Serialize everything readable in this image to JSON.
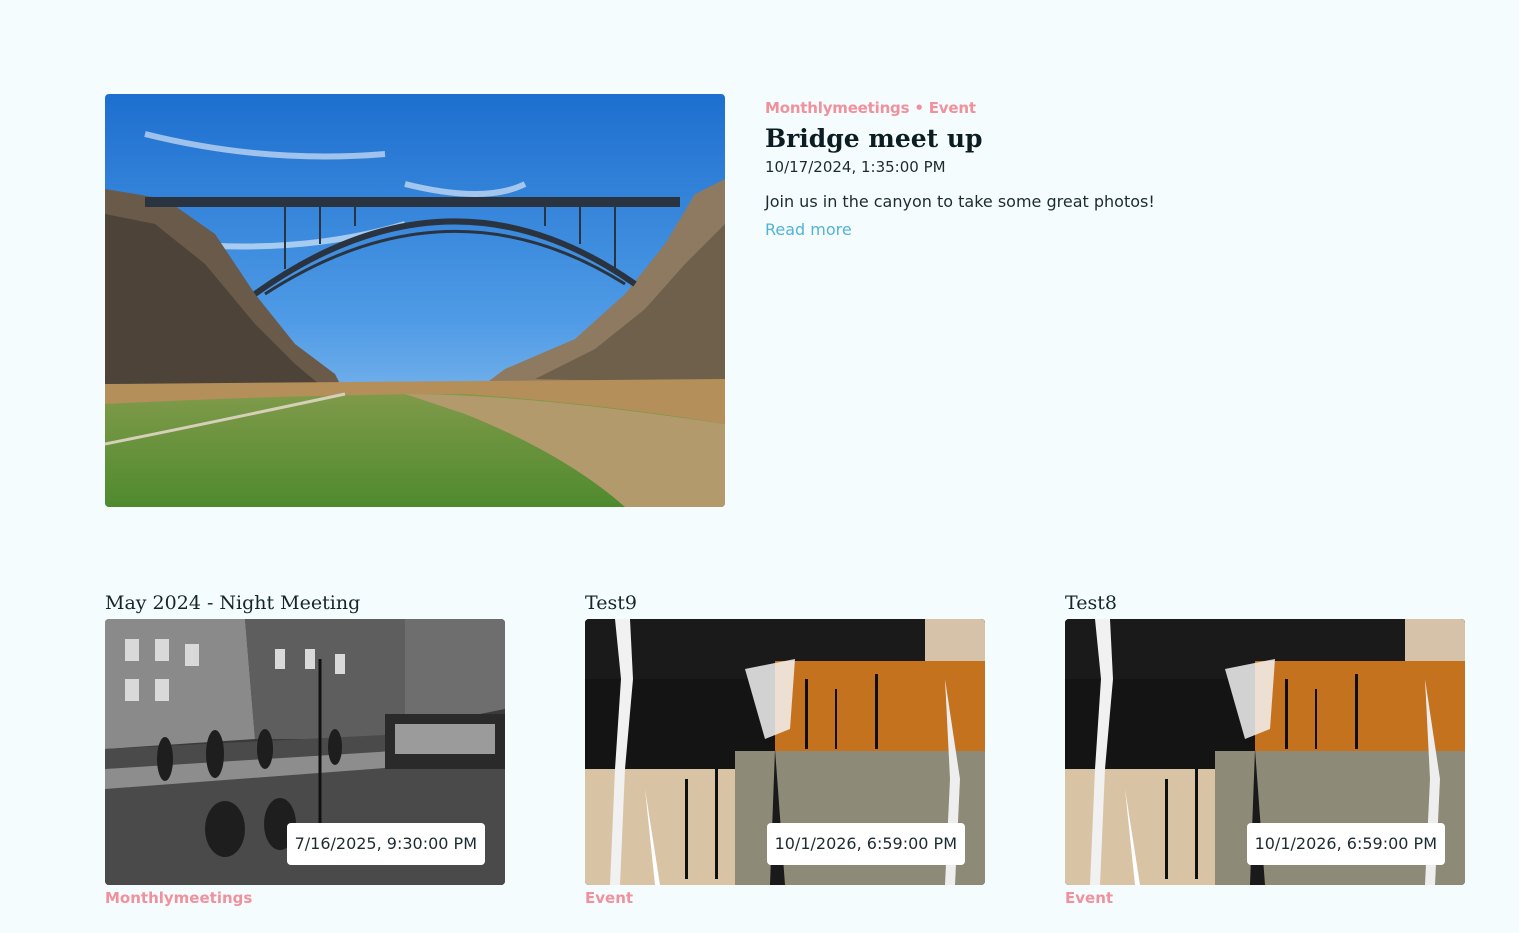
{
  "featured": {
    "category_line": "Monthlymeetings • Event",
    "title": "Bridge meet up",
    "date": "10/17/2024, 1:35:00 PM",
    "description": "Join us in the canyon to take some great photos!",
    "read_more": "Read more",
    "image_icon": "bridge-canyon-photo"
  },
  "cards": [
    {
      "title": "May 2024 - Night Meeting",
      "date": "7/16/2025, 9:30:00 PM",
      "category": "Monthlymeetings",
      "image_icon": "night-street-photo"
    },
    {
      "title": "Test9",
      "date": "10/1/2026, 6:59:00 PM",
      "category": "Event",
      "image_icon": "abstract-paint-image"
    },
    {
      "title": "Test8",
      "date": "10/1/2026, 6:59:00 PM",
      "category": "Event",
      "image_icon": "abstract-paint-image"
    }
  ],
  "colors": {
    "background": "#f4fcfd",
    "category_pink": "#f0919d",
    "link_blue": "#52b3d6",
    "heading": "#0c1d22"
  }
}
